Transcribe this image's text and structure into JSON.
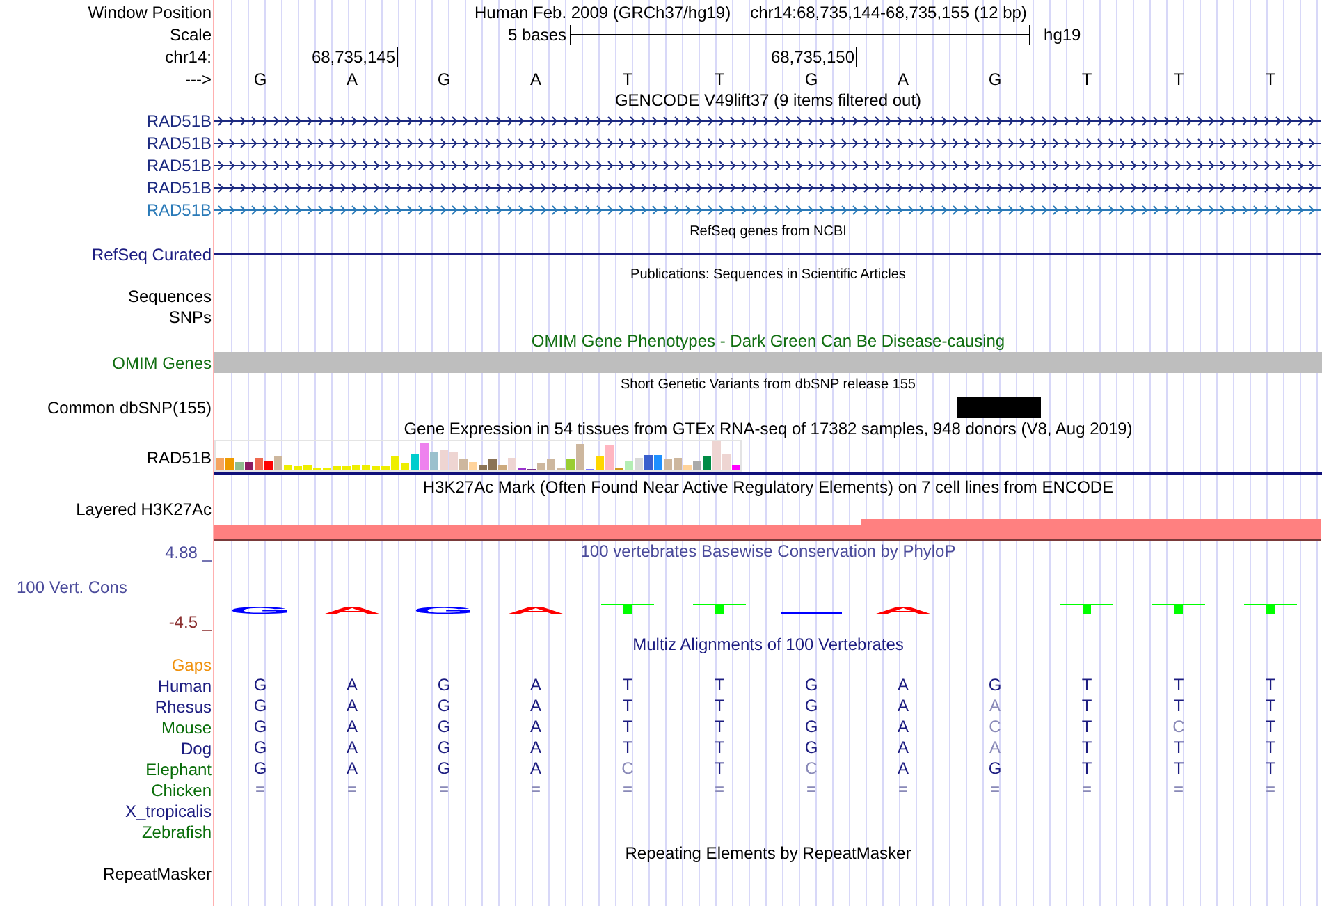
{
  "header": {
    "label": "Window Position",
    "assembly_text": "Human Feb. 2009 (GRCh37/hg19)",
    "range": "chr14:68,735,144-68,735,155 (12 bp)"
  },
  "scale": {
    "label": "Scale",
    "length": "5 bases",
    "assembly": "hg19"
  },
  "ruler": {
    "label": "chr14:"
  },
  "sequence": {
    "label": "--->",
    "bases": [
      {
        "letter": "G"
      },
      {
        "letter": "A",
        "coordinate": "68,735,145"
      },
      {
        "letter": "G"
      },
      {
        "letter": "A"
      },
      {
        "letter": "T"
      },
      {
        "letter": "T"
      },
      {
        "letter": "G",
        "coordinate": "68,735,150"
      },
      {
        "letter": "A"
      },
      {
        "letter": "G"
      },
      {
        "letter": "T"
      },
      {
        "letter": "T"
      },
      {
        "letter": "T"
      }
    ]
  },
  "tracks": [
    {
      "kind": "genes",
      "title": "GENCODE V49lift37 (9 items filtered out)",
      "items": [
        {
          "label": "RAD51B",
          "color": "#1c2a80"
        },
        {
          "label": "RAD51B",
          "color": "#1c2a80"
        },
        {
          "label": "RAD51B",
          "color": "#1c2a80"
        },
        {
          "label": "RAD51B",
          "color": "#1c2a80"
        },
        {
          "label": "RAD51B",
          "color": "#2a7ab8"
        }
      ]
    },
    {
      "kind": "line",
      "title": "RefSeq genes from NCBI",
      "label": "RefSeq Curated"
    },
    {
      "kind": "empty",
      "title": "Publications: Sequences in Scientific Articles",
      "labels": [
        "Sequences",
        "SNPs"
      ]
    },
    {
      "kind": "bar",
      "title": "OMIM Gene Phenotypes - Dark Green Can Be Disease-causing",
      "label": "OMIM Genes"
    },
    {
      "kind": "variants",
      "title": "Short Genetic Variants from dbSNP release 155",
      "label": "Common dbSNP(155)"
    },
    {
      "kind": "expression",
      "title": "Gene Expression in 54 tissues from GTEx RNA-seq of 17382 samples, 948 donors (V8, Aug 2019)",
      "label": "RAD51B"
    },
    {
      "kind": "signal",
      "title": "H3K27Ac Mark (Often Found Near Active Regulatory Elements) on 7 cell lines from ENCODE",
      "label": "Layered H3K27Ac"
    },
    {
      "kind": "conservation",
      "title": "100 vertebrates Basewise Conservation by PhyloP",
      "label": "100 Vert. Cons",
      "max": "4.88 _",
      "min": "-4.5 _",
      "columns": [
        {
          "kind": "letter",
          "text": "G",
          "color": "#0000ff"
        },
        {
          "kind": "letter",
          "text": "A",
          "color": "#ff0000"
        },
        {
          "kind": "letter",
          "text": "G",
          "color": "#0000ff"
        },
        {
          "kind": "letter",
          "text": "A",
          "color": "#ff0000"
        },
        {
          "kind": "bar",
          "color": "#00ff00"
        },
        {
          "kind": "bar",
          "color": "#00ff00"
        },
        {
          "kind": "flat",
          "color": "#0000ff"
        },
        {
          "kind": "letter",
          "text": "A",
          "color": "#ff0000"
        },
        {
          "kind": "blank"
        },
        {
          "kind": "bar",
          "color": "#00ff00"
        },
        {
          "kind": "bar",
          "color": "#00ff00"
        },
        {
          "kind": "bar",
          "color": "#00ff00"
        }
      ]
    },
    {
      "kind": "alignment",
      "title": "Multiz Alignments of 100 Vertebrates",
      "gaps_label": "Gaps",
      "species": [
        {
          "name": "Human",
          "color": "#1c1c80",
          "bases": [
            {
              "text": "G",
              "match": true
            },
            {
              "text": "A",
              "match": true
            },
            {
              "text": "G",
              "match": true
            },
            {
              "text": "A",
              "match": true
            },
            {
              "text": "T",
              "match": true
            },
            {
              "text": "T",
              "match": true
            },
            {
              "text": "G",
              "match": true
            },
            {
              "text": "A",
              "match": true
            },
            {
              "text": "G",
              "match": true
            },
            {
              "text": "T",
              "match": true
            },
            {
              "text": "T",
              "match": true
            },
            {
              "text": "T",
              "match": true
            }
          ]
        },
        {
          "name": "Rhesus",
          "color": "#1c1c80",
          "bases": [
            {
              "text": "G",
              "match": true
            },
            {
              "text": "A",
              "match": true
            },
            {
              "text": "G",
              "match": true
            },
            {
              "text": "A",
              "match": true
            },
            {
              "text": "T",
              "match": true
            },
            {
              "text": "T",
              "match": true
            },
            {
              "text": "G",
              "match": true
            },
            {
              "text": "A",
              "match": true
            },
            {
              "text": "A",
              "match": false
            },
            {
              "text": "T",
              "match": true
            },
            {
              "text": "T",
              "match": true
            },
            {
              "text": "T",
              "match": true
            }
          ]
        },
        {
          "name": "Mouse",
          "color": "#0a6e0a",
          "bases": [
            {
              "text": "G",
              "match": true
            },
            {
              "text": "A",
              "match": true
            },
            {
              "text": "G",
              "match": true
            },
            {
              "text": "A",
              "match": true
            },
            {
              "text": "T",
              "match": true
            },
            {
              "text": "T",
              "match": true
            },
            {
              "text": "G",
              "match": true
            },
            {
              "text": "A",
              "match": true
            },
            {
              "text": "C",
              "match": false
            },
            {
              "text": "T",
              "match": true
            },
            {
              "text": "C",
              "match": false
            },
            {
              "text": "T",
              "match": true
            }
          ]
        },
        {
          "name": "Dog",
          "color": "#1c1c80",
          "bases": [
            {
              "text": "G",
              "match": true
            },
            {
              "text": "A",
              "match": true
            },
            {
              "text": "G",
              "match": true
            },
            {
              "text": "A",
              "match": true
            },
            {
              "text": "T",
              "match": true
            },
            {
              "text": "T",
              "match": true
            },
            {
              "text": "G",
              "match": true
            },
            {
              "text": "A",
              "match": true
            },
            {
              "text": "A",
              "match": false
            },
            {
              "text": "T",
              "match": true
            },
            {
              "text": "T",
              "match": true
            },
            {
              "text": "T",
              "match": true
            }
          ]
        },
        {
          "name": "Elephant",
          "color": "#0a6e0a",
          "bases": [
            {
              "text": "G",
              "match": true
            },
            {
              "text": "A",
              "match": true
            },
            {
              "text": "G",
              "match": true
            },
            {
              "text": "A",
              "match": true
            },
            {
              "text": "C",
              "match": false
            },
            {
              "text": "T",
              "match": true
            },
            {
              "text": "C",
              "match": false
            },
            {
              "text": "A",
              "match": true
            },
            {
              "text": "G",
              "match": true
            },
            {
              "text": "T",
              "match": true
            },
            {
              "text": "T",
              "match": true
            },
            {
              "text": "T",
              "match": true
            }
          ]
        },
        {
          "name": "Chicken",
          "color": "#0a6e0a",
          "bases": [
            {
              "text": "=",
              "match": false
            },
            {
              "text": "=",
              "match": false
            },
            {
              "text": "=",
              "match": false
            },
            {
              "text": "=",
              "match": false
            },
            {
              "text": "=",
              "match": false
            },
            {
              "text": "=",
              "match": false
            },
            {
              "text": "=",
              "match": false
            },
            {
              "text": "=",
              "match": false
            },
            {
              "text": "=",
              "match": false
            },
            {
              "text": "=",
              "match": false
            },
            {
              "text": "=",
              "match": false
            },
            {
              "text": "=",
              "match": false
            }
          ]
        },
        {
          "name": "X_tropicalis",
          "color": "#1c1c80"
        },
        {
          "name": "Zebrafish",
          "color": "#0a6e0a"
        }
      ]
    },
    {
      "kind": "repeats",
      "title": "Repeating Elements by RepeatMasker",
      "label": "RepeatMasker"
    }
  ]
}
